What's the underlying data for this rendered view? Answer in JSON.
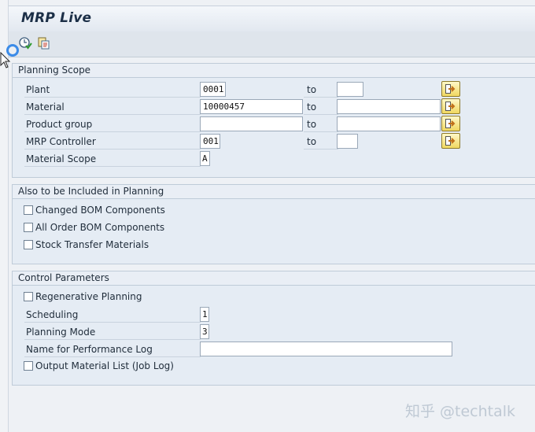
{
  "window": {
    "title": "MRP Live"
  },
  "toolbar": {
    "execute_icon": "clock-execute-icon",
    "copy_icon": "copy-variant-icon"
  },
  "planning_scope": {
    "header": "Planning Scope",
    "to_label": "to",
    "rows": [
      {
        "label": "Plant",
        "from": "0001",
        "to": ""
      },
      {
        "label": "Material",
        "from": "10000457",
        "to": ""
      },
      {
        "label": "Product group",
        "from": "",
        "to": ""
      },
      {
        "label": "MRP Controller",
        "from": "001",
        "to": ""
      }
    ],
    "material_scope": {
      "label": "Material Scope",
      "value": "A"
    }
  },
  "also_included": {
    "header": "Also to be Included in Planning",
    "options": [
      {
        "label": "Changed BOM Components",
        "checked": false
      },
      {
        "label": "All Order BOM Components",
        "checked": false
      },
      {
        "label": "Stock Transfer Materials",
        "checked": false
      }
    ]
  },
  "control_parameters": {
    "header": "Control Parameters",
    "regenerative": {
      "label": "Regenerative Planning",
      "checked": false
    },
    "scheduling": {
      "label": "Scheduling",
      "value": "1"
    },
    "planning_mode": {
      "label": "Planning Mode",
      "value": "3"
    },
    "performance_log": {
      "label": "Name for Performance Log",
      "value": ""
    },
    "output_list": {
      "label": "Output Material List (Job Log)",
      "checked": false
    }
  },
  "watermark": "知乎 @techtalk"
}
